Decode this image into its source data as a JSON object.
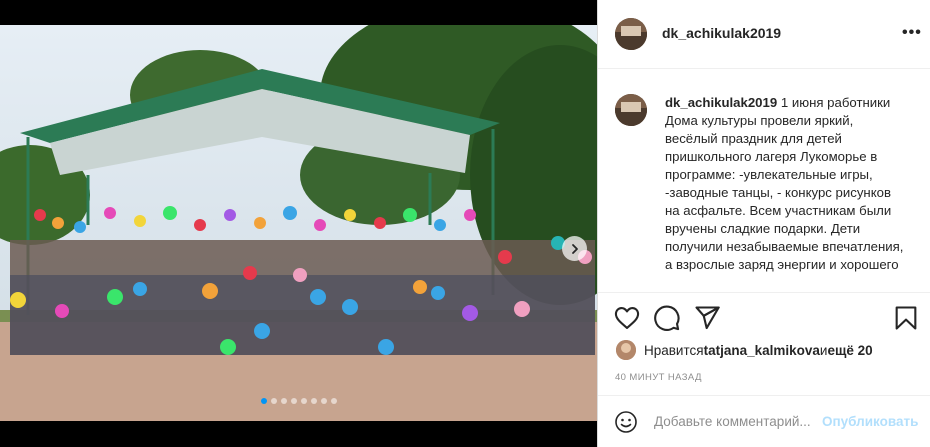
{
  "post": {
    "username": "dk_achikulak2019",
    "more_label": "•••",
    "caption": {
      "username": "dk_achikulak2019",
      "text": " 1 июня работники Дома культуры провели яркий, весёлый праздник для детей пришкольного лагеря Лукоморье в программе: -увлекательные игры, -заводные танцы, - конкурс рисунков на асфальте. Всем участникам были вручены сладкие подарки. Дети получили незабываемые впечатления, а взрослые заряд энергии и хорошего"
    },
    "likes": {
      "prefix": "Нравится ",
      "user": "tatjana_kalmikova",
      "middle": " и ",
      "rest": "ещё 20"
    },
    "time_ago": "40 МИНУТ НАЗАД",
    "comment": {
      "placeholder": "Добавьте комментарий...",
      "publish_label": "Опубликовать"
    },
    "carousel": {
      "total": 8,
      "active_index": 0
    }
  },
  "icons": [
    "heart-icon",
    "comment-icon",
    "share-icon",
    "bookmark-icon",
    "emoji-icon",
    "chevron-right-icon"
  ],
  "colors": {
    "accent": "#0095f6",
    "publish_disabled": "#b2dffc",
    "muted": "#8e8e8e"
  }
}
